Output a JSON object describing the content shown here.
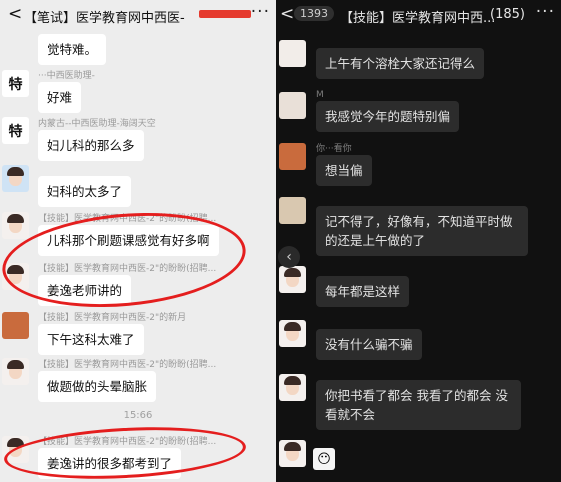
{
  "left": {
    "back": "<",
    "title": "【笔试】医学教育网中西医-",
    "more": "···",
    "time": "15:66",
    "messages": [
      {
        "sender": "",
        "text": "觉特难。"
      },
      {
        "sender": "···中西医助理-",
        "text": "好难"
      },
      {
        "sender": "内蒙古--中西医助理-海阔天空",
        "text": "妇儿科的那么多"
      },
      {
        "sender": "",
        "text": "妇科的太多了"
      },
      {
        "sender": "【技能】医学教育网中西医-2\"的盼盼(招聘...",
        "text": "儿科那个刷题课感觉有好多啊"
      },
      {
        "sender": "【技能】医学教育网中西医-2\"的盼盼(招聘...",
        "text": "姜逸老师讲的"
      },
      {
        "sender": "【技能】医学教育网中西医-2\"的新月",
        "text": "下午这科太难了"
      },
      {
        "sender": "【技能】医学教育网中西医-2\"的盼盼(招聘...",
        "text": "做题做的头晕脑胀"
      },
      {
        "sender": "【技能】医学教育网中西医-2\"的盼盼(招聘...",
        "text": "姜逸讲的很多都考到了"
      }
    ]
  },
  "right": {
    "back": "<",
    "unread": "1393",
    "title": "【技能】医学教育网中西...",
    "count": "(185)",
    "more": "···",
    "messages": [
      {
        "sender": "",
        "text": "上午有个溶栓大家还记得么"
      },
      {
        "sender": "M",
        "text": "我感觉今年的题特别偏"
      },
      {
        "sender": "你···看你",
        "text": "想当偏"
      },
      {
        "sender": "",
        "text": "记不得了，好像有，不知道平时做的还是上午做的了"
      },
      {
        "sender": "",
        "text": "每年都是这样"
      },
      {
        "sender": "",
        "text": "没有什么骗不骗"
      },
      {
        "sender": "",
        "text": "你把书看了都会 我看了的都会 没看就不会"
      }
    ],
    "sticker": "😶"
  },
  "avatar_glyph": "特",
  "accent": "#e41e1e"
}
